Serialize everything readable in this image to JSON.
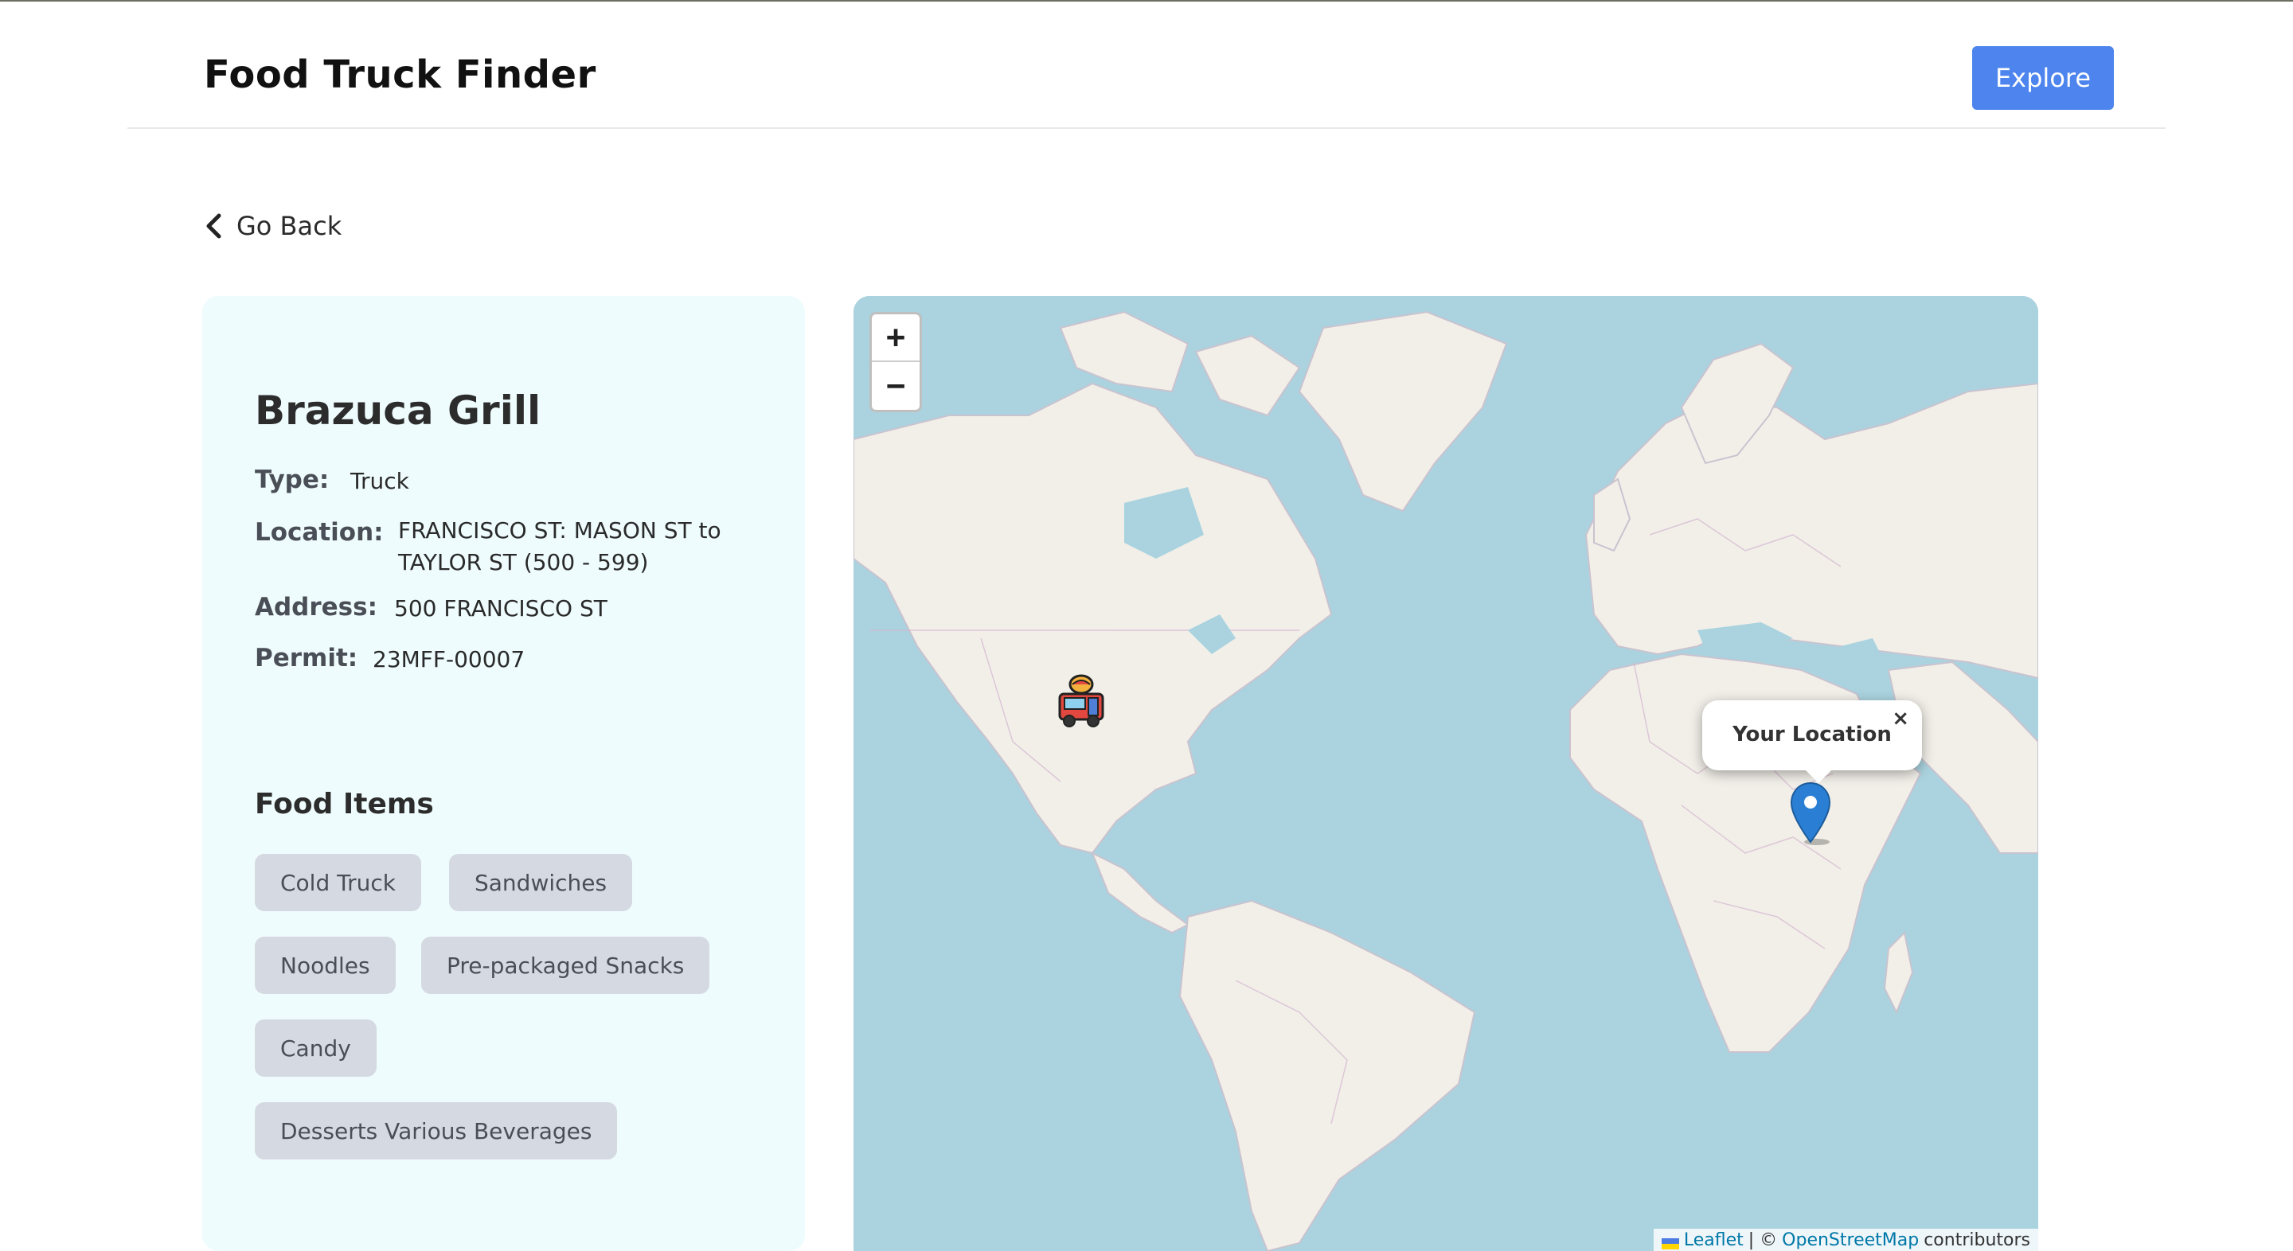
{
  "header": {
    "title": "Food Truck Finder",
    "explore_label": "Explore"
  },
  "nav": {
    "back_label": "Go Back"
  },
  "truck": {
    "name": "Brazuca Grill",
    "fields": [
      {
        "key": "Type:",
        "value": "Truck"
      },
      {
        "key": "Location:",
        "value": "FRANCISCO ST: MASON ST to TAYLOR ST (500 - 599)"
      },
      {
        "key": "Address:",
        "value": "500 FRANCISCO ST"
      },
      {
        "key": "Permit:",
        "value": "23MFF-00007"
      }
    ],
    "food_items_title": "Food Items",
    "food_items": [
      "Cold Truck",
      "Sandwiches",
      "Noodles",
      "Pre-packaged Snacks",
      "Candy",
      "Desserts Various Beverages"
    ]
  },
  "map": {
    "zoom_in": "+",
    "zoom_out": "−",
    "popup_text": "Your Location",
    "popup_close": "×",
    "attribution": {
      "leaflet": "Leaflet",
      "sep": "| ©",
      "osm": "OpenStreetMap",
      "suffix": "contributors"
    },
    "colors": {
      "water": "#aad3df",
      "land": "#f2efe9",
      "marker": "#2a7fd4"
    }
  },
  "colors": {
    "accent": "#4d84ee",
    "card_bg": "#effcfd",
    "chip_bg": "#d4d9e2"
  }
}
